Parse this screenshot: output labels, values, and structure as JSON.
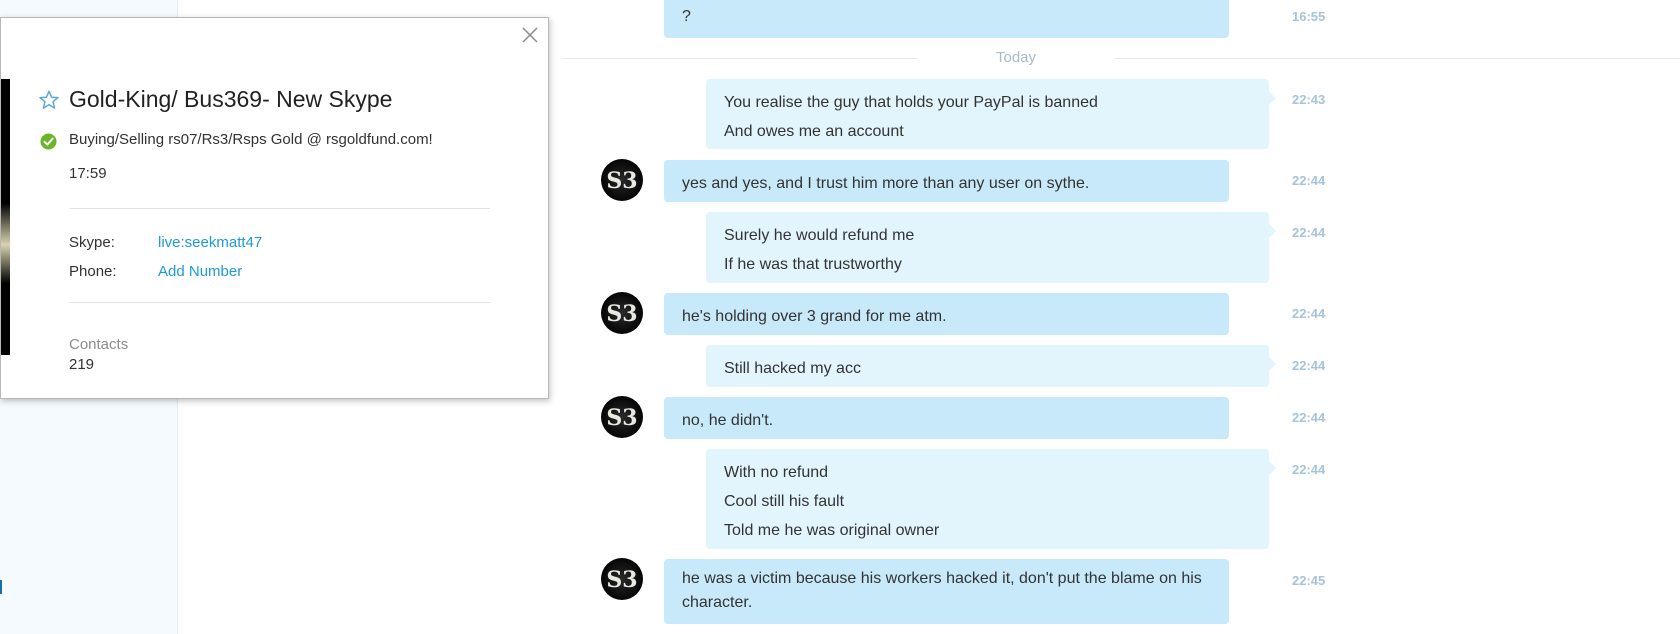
{
  "profile_card": {
    "display_name": "Gold-King/ Bus369- New Skype",
    "mood": "Buying/Selling rs07/Rs3/Rsps Gold @ rsgoldfund.com!",
    "local_time": "17:59",
    "skype_label": "Skype:",
    "skype_value": "live:seekmatt47",
    "phone_label": "Phone:",
    "phone_value": "Add Number",
    "contacts_label": "Contacts",
    "contacts_count": "219",
    "status_color": "#6bb52a",
    "favorite_icon": "star-outline-icon",
    "close_icon": "close-icon"
  },
  "conversation": {
    "day_label": "Today",
    "messages": [
      {
        "direction": "in",
        "lines": [
          "?"
        ],
        "time": "16:55"
      },
      {
        "direction": "out",
        "lines": [
          "You realise the guy that holds your PayPal is banned",
          "And owes me an account"
        ],
        "time": "22:43"
      },
      {
        "direction": "in",
        "lines": [
          "yes and yes, and I trust him more than any user on sythe."
        ],
        "time": "22:44"
      },
      {
        "direction": "out",
        "lines": [
          "Surely he would refund me",
          "If he was that trustworthy"
        ],
        "time": "22:44"
      },
      {
        "direction": "in",
        "lines": [
          "he's holding over 3 grand for me atm."
        ],
        "time": "22:44"
      },
      {
        "direction": "out",
        "lines": [
          "Still hacked my acc"
        ],
        "time": "22:44"
      },
      {
        "direction": "in",
        "lines": [
          "no, he didn't."
        ],
        "time": "22:44"
      },
      {
        "direction": "out",
        "lines": [
          "With no refund",
          "Cool still his fault",
          "Told me he was original owner"
        ],
        "time": "22:44"
      },
      {
        "direction": "in",
        "lines": [
          "he was a victim because his workers hacked it, don't put the blame on his character."
        ],
        "time": "22:45"
      }
    ]
  },
  "colors": {
    "incoming_bubble": "#c7e9f9",
    "outgoing_bubble": "#e2f4fc",
    "timestamp": "#a6c4d8",
    "link": "#1e9ad6"
  }
}
